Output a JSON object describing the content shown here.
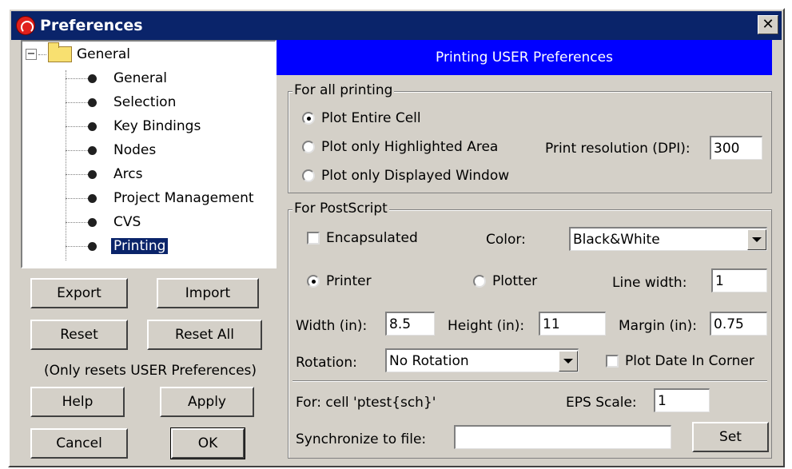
{
  "window": {
    "title": "Preferences",
    "close_label": "✕"
  },
  "tree": {
    "root": {
      "label": "General",
      "expander": "−"
    },
    "items": [
      {
        "label": "General"
      },
      {
        "label": "Selection"
      },
      {
        "label": "Key Bindings"
      },
      {
        "label": "Nodes"
      },
      {
        "label": "Arcs"
      },
      {
        "label": "Project Management"
      },
      {
        "label": "CVS"
      },
      {
        "label": "Printing",
        "selected": true
      }
    ]
  },
  "buttons": {
    "export": "Export",
    "import": "Import",
    "reset": "Reset",
    "reset_all": "Reset All",
    "reset_note": "(Only resets USER Preferences)",
    "help": "Help",
    "apply": "Apply",
    "cancel": "Cancel",
    "ok": "OK"
  },
  "panel": {
    "header": "Printing USER Preferences",
    "all_printing": {
      "title": "For all printing",
      "options": [
        {
          "label": "Plot Entire Cell",
          "checked": true
        },
        {
          "label": "Plot only Highlighted Area",
          "checked": false
        },
        {
          "label": "Plot only Displayed Window",
          "checked": false
        }
      ],
      "resolution_label": "Print resolution (DPI):",
      "resolution_value": "300"
    },
    "postscript": {
      "title": "For PostScript",
      "encapsulated_label": "Encapsulated",
      "encapsulated_checked": false,
      "color_label": "Color:",
      "color_value": "Black&White",
      "printer_label": "Printer",
      "printer_checked": true,
      "plotter_label": "Plotter",
      "plotter_checked": false,
      "line_width_label": "Line width:",
      "line_width_value": "1",
      "width_label": "Width (in):",
      "width_value": "8.5",
      "height_label": "Height (in):",
      "height_value": "11",
      "margin_label": "Margin (in):",
      "margin_value": "0.75",
      "rotation_label": "Rotation:",
      "rotation_value": "No Rotation",
      "plot_date_label": "Plot Date In Corner",
      "plot_date_checked": false,
      "for_cell_label": "For: cell 'ptest{sch}'",
      "eps_scale_label": "EPS Scale:",
      "eps_scale_value": "1",
      "sync_label": "Synchronize to file:",
      "sync_value": "",
      "set_label": "Set"
    }
  }
}
